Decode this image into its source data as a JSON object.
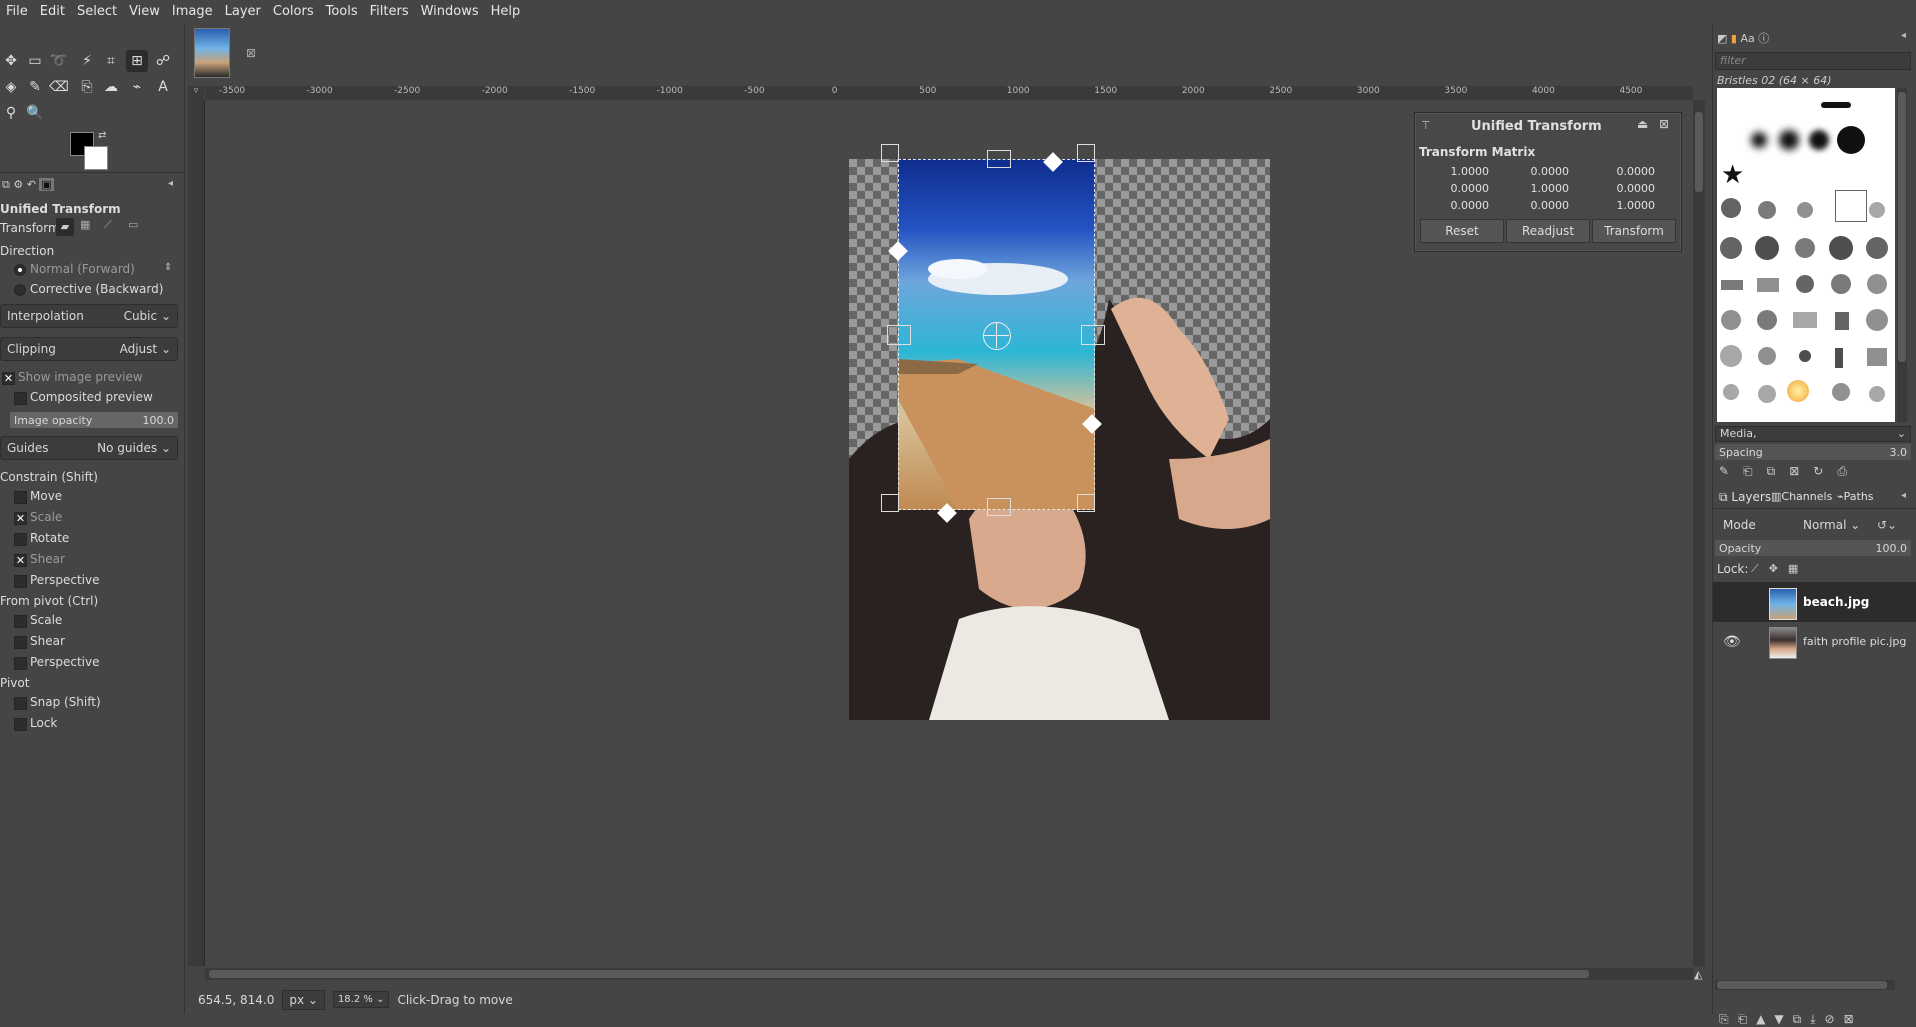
{
  "menubar": {
    "items": [
      "File",
      "Edit",
      "Select",
      "View",
      "Image",
      "Layer",
      "Colors",
      "Tools",
      "Filters",
      "Windows",
      "Help"
    ]
  },
  "tool_options": {
    "title": "Unified Transform",
    "transform_label": "Transform:",
    "direction_label": "Direction",
    "direction_forward": "Normal (Forward)",
    "direction_backward": "Corrective (Backward)",
    "interpolation_label": "Interpolation",
    "interpolation_value": "Cubic",
    "clipping_label": "Clipping",
    "clipping_value": "Adjust",
    "show_preview": "Show image preview",
    "composited_preview": "Composited preview",
    "image_opacity_label": "Image opacity",
    "image_opacity_value": "100.0",
    "guides_label": "Guides",
    "guides_value": "No guides",
    "constrain_label": "Constrain (Shift)",
    "constrain_move": "Move",
    "constrain_scale": "Scale",
    "constrain_rotate": "Rotate",
    "constrain_shear": "Shear",
    "constrain_perspective": "Perspective",
    "from_pivot_label": "From pivot  (Ctrl)",
    "pivot_scale": "Scale",
    "pivot_shear": "Shear",
    "pivot_perspective": "Perspective",
    "pivot_label": "Pivot",
    "pivot_snap": "Snap (Shift)",
    "pivot_lock": "Lock"
  },
  "ruler": {
    "ticks": [
      "-3500",
      "-3000",
      "-2500",
      "-2000",
      "-1500",
      "-1000",
      "-500",
      "0",
      "500",
      "1000",
      "1500",
      "2000",
      "2500",
      "3000",
      "3500",
      "4000",
      "4500"
    ]
  },
  "status": {
    "coords": "654.5, 814.0",
    "unit": "px",
    "zoom": "18.2 %",
    "message": "Click-Drag to move"
  },
  "transform_dialog": {
    "title": "Unified Transform",
    "matrix_label": "Transform Matrix",
    "matrix": [
      [
        "1.0000",
        "0.0000",
        "0.0000"
      ],
      [
        "0.0000",
        "1.0000",
        "0.0000"
      ],
      [
        "0.0000",
        "0.0000",
        "1.0000"
      ]
    ],
    "reset": "Reset",
    "readjust": "Readjust",
    "transform": "Transform"
  },
  "brushes": {
    "filter_placeholder": "filter",
    "current": "Bristles 02 (64 × 64)",
    "tag": "Media,",
    "spacing_label": "Spacing",
    "spacing_value": "3.0"
  },
  "layers_panel": {
    "tabs": [
      "Layers",
      "Channels",
      "Paths"
    ],
    "mode_label": "Mode",
    "mode_value": "Normal",
    "opacity_label": "Opacity",
    "opacity_value": "100.0",
    "lock_label": "Lock:",
    "layers": [
      {
        "name": "beach.jpg",
        "visible": false
      },
      {
        "name": "faith profile pic.jpg",
        "visible": true
      }
    ]
  },
  "colors": {
    "foreground": "#000000",
    "background": "#ffffff"
  }
}
